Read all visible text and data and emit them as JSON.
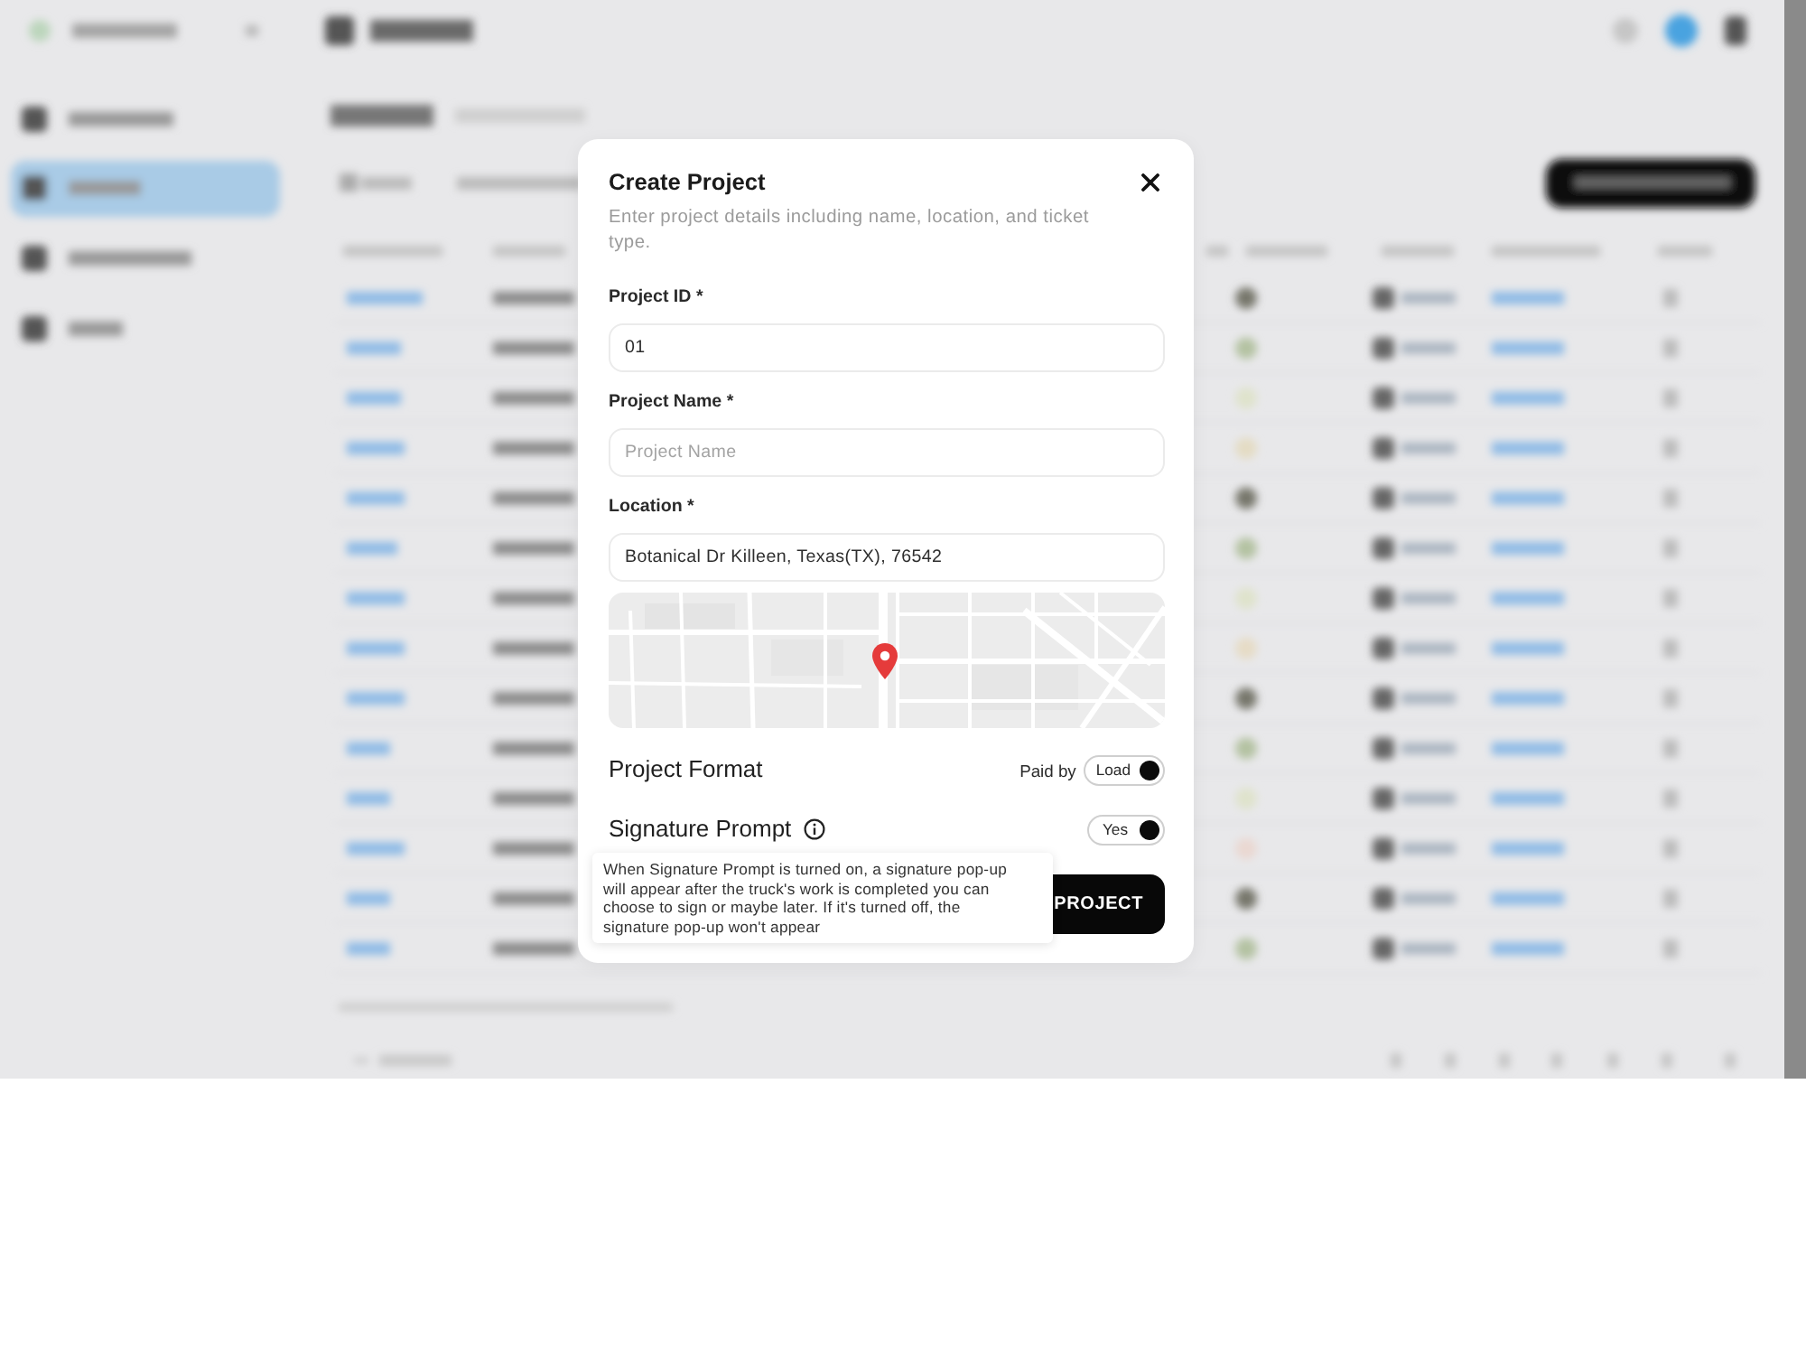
{
  "dialog": {
    "title": "Create Project",
    "description": "Enter project details including name, location, and ticket type.",
    "fields": [
      {
        "label": "Project ID *",
        "value": "01"
      },
      {
        "label": "Project Name *",
        "placeholder": "Project Name"
      },
      {
        "label": "Location *",
        "value": "Botanical Dr Killeen, Texas(TX), 76542"
      }
    ],
    "settings": [
      {
        "label": "Project Format",
        "prefix": "Paid by",
        "toggle_label": "Load",
        "on": true,
        "info": false
      },
      {
        "label": "Signature Prompt",
        "toggle_label": "Yes",
        "on": true,
        "info": true
      }
    ],
    "tooltip": "When Signature Prompt is turned on, a signature pop-up\nwill appear after the truck's work is completed you can\nchoose to sign or maybe later. If it's turned off, the\nsignature pop-up won't appear",
    "submit_button": "PROJECT"
  }
}
